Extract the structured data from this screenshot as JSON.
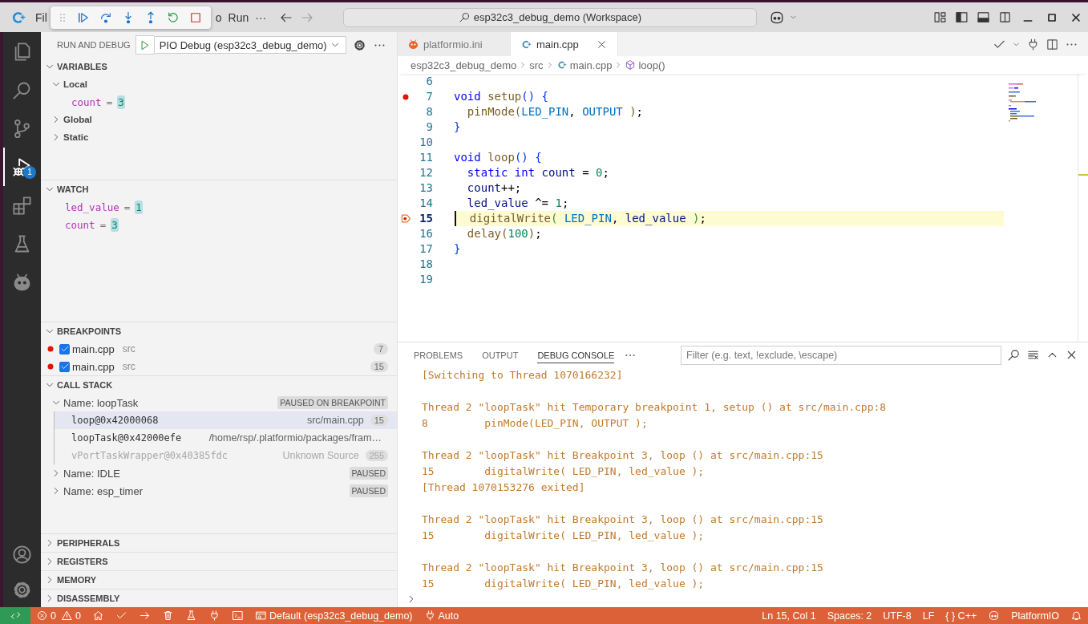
{
  "title_bar": {
    "menu_left": [
      "Fil"
    ],
    "menu_right": [
      "o",
      "Run",
      "···"
    ],
    "command_center": "esp32c3_debug_demo (Workspace)"
  },
  "activity_bar": {
    "items": [
      {
        "kind": "files",
        "selected": false
      },
      {
        "kind": "search",
        "selected": false
      },
      {
        "kind": "scm",
        "selected": false
      },
      {
        "kind": "debug",
        "selected": true,
        "badge": "1"
      },
      {
        "kind": "extensions",
        "selected": false
      },
      {
        "kind": "flask",
        "selected": false
      },
      {
        "kind": "alien",
        "selected": false
      }
    ],
    "bottom": [
      {
        "kind": "account",
        "selected": false
      },
      {
        "kind": "gear",
        "selected": false
      }
    ]
  },
  "sidebar": {
    "title": "RUN AND DEBUG",
    "config": "PIO Debug (esp32c3_debug_demo)",
    "sections": [
      {
        "kind": "variables",
        "title": "VARIABLES",
        "expanded": true,
        "scopes": [
          {
            "label": "Local",
            "expanded": true,
            "children": [
              {
                "name": "count",
                "sep": "=",
                "value": "3",
                "changed": true
              }
            ]
          },
          {
            "label": "Global",
            "expanded": false
          },
          {
            "label": "Static",
            "expanded": false
          }
        ]
      },
      {
        "kind": "watch",
        "title": "WATCH",
        "expanded": true,
        "items": [
          {
            "name": "led_value",
            "sep": "=",
            "value": "1",
            "changed": true
          },
          {
            "name": "count",
            "sep": "=",
            "value": "3",
            "changed": true
          }
        ]
      },
      {
        "kind": "breakpoints",
        "title": "BREAKPOINTS",
        "expanded": true,
        "items": [
          {
            "file": "main.cpp",
            "folder": "src",
            "line": "7",
            "checked": true
          },
          {
            "file": "main.cpp",
            "folder": "src",
            "line": "15",
            "checked": true
          }
        ]
      },
      {
        "kind": "callstack",
        "title": "CALL STACK",
        "expanded": true,
        "threads": [
          {
            "name": "Name: loopTask",
            "status": "PAUSED ON BREAKPOINT",
            "expanded": true,
            "frames": [
              {
                "name": "loop@0x42000068",
                "source": "src/main.cpp",
                "line": "15",
                "selected": true,
                "dimmed": false
              },
              {
                "name": "loopTask@0x42000efe",
                "source": "/home/rsp/.platformio/packages/fram…",
                "selected": false,
                "dimmed": false
              },
              {
                "name": "vPortTaskWrapper@0x40385fdc",
                "source": "Unknown Source",
                "line": "255",
                "selected": false,
                "dimmed": true
              }
            ]
          },
          {
            "name": "Name: IDLE",
            "status": "PAUSED",
            "expanded": false
          },
          {
            "name": "Name: esp_timer",
            "status": "PAUSED",
            "expanded": false
          }
        ]
      },
      {
        "kind": "collapsed",
        "title": "PERIPHERALS",
        "expanded": false
      },
      {
        "kind": "collapsed",
        "title": "REGISTERS",
        "expanded": false
      },
      {
        "kind": "collapsed",
        "title": "MEMORY",
        "expanded": false
      },
      {
        "kind": "collapsed",
        "title": "DISASSEMBLY",
        "expanded": false
      }
    ]
  },
  "editor": {
    "tabs": [
      {
        "label": "platformio.ini",
        "kind": "ini",
        "selected": false
      },
      {
        "label": "main.cpp",
        "kind": "cpp",
        "selected": true
      }
    ],
    "breadcrumbs": [
      {
        "label": "esp32c3_debug_demo",
        "kind": "folder"
      },
      {
        "label": "src",
        "kind": "folder"
      },
      {
        "label": "main.cpp",
        "kind": "file"
      },
      {
        "label": "loop()",
        "kind": "symbol"
      }
    ],
    "lines": [
      {
        "number": "6",
        "active": false,
        "breakpoint": false
      },
      {
        "number": "7",
        "active": false,
        "breakpoint": true,
        "tokens": [
          {
            "text": "void ",
            "kind": "kw"
          },
          {
            "text": "setup",
            "kind": "fn"
          },
          {
            "text": "() {",
            "kind": "br"
          }
        ]
      },
      {
        "number": "8",
        "active": false,
        "breakpoint": false,
        "tokens": [
          {
            "text": "  pinMode",
            "kind": "fn"
          },
          {
            "text": "(",
            "kind": "fn"
          },
          {
            "text": "LED_PIN",
            "kind": "mac"
          },
          {
            "text": ", ",
            "kind": "p"
          },
          {
            "text": "OUTPUT",
            "kind": "mac"
          },
          {
            "text": " )",
            "kind": "fn"
          },
          {
            "text": ";",
            "kind": "p"
          }
        ]
      },
      {
        "number": "9",
        "active": false,
        "breakpoint": false,
        "tokens": [
          {
            "text": "}",
            "kind": "br"
          }
        ]
      },
      {
        "number": "10",
        "active": false,
        "breakpoint": false
      },
      {
        "number": "11",
        "active": false,
        "breakpoint": false,
        "tokens": [
          {
            "text": "void ",
            "kind": "kw"
          },
          {
            "text": "loop",
            "kind": "fn"
          },
          {
            "text": "() {",
            "kind": "br"
          }
        ]
      },
      {
        "number": "12",
        "active": false,
        "breakpoint": false,
        "tokens": [
          {
            "text": "  static int ",
            "kind": "kw"
          },
          {
            "text": "count",
            "kind": "var"
          },
          {
            "text": " = ",
            "kind": "p"
          },
          {
            "text": "0",
            "kind": "num"
          },
          {
            "text": ";",
            "kind": "p"
          }
        ]
      },
      {
        "number": "13",
        "active": false,
        "breakpoint": false,
        "tokens": [
          {
            "text": "  count",
            "kind": "var"
          },
          {
            "text": "++;",
            "kind": "p"
          }
        ]
      },
      {
        "number": "14",
        "active": false,
        "breakpoint": false,
        "tokens": [
          {
            "text": "  led_value",
            "kind": "var"
          },
          {
            "text": " ^= ",
            "kind": "p"
          },
          {
            "text": "1",
            "kind": "num"
          },
          {
            "text": ";",
            "kind": "p"
          }
        ]
      },
      {
        "number": "15",
        "active": true,
        "breakpoint": true,
        "tokens": [
          {
            "text": "  digitalWrite",
            "kind": "fn"
          },
          {
            "text": "( ",
            "kind": "br2"
          },
          {
            "text": "LED_PIN",
            "kind": "mac"
          },
          {
            "text": ", ",
            "kind": "p"
          },
          {
            "text": "led_value",
            "kind": "var"
          },
          {
            "text": " )",
            "kind": "br2"
          },
          {
            "text": ";",
            "kind": "p"
          }
        ]
      },
      {
        "number": "16",
        "active": false,
        "breakpoint": false,
        "tokens": [
          {
            "text": "  delay",
            "kind": "fn"
          },
          {
            "text": "(",
            "kind": "fn"
          },
          {
            "text": "100",
            "kind": "num"
          },
          {
            "text": ")",
            "kind": "fn"
          },
          {
            "text": ";",
            "kind": "p"
          }
        ]
      },
      {
        "number": "17",
        "active": false,
        "breakpoint": false,
        "tokens": [
          {
            "text": "}",
            "kind": "br"
          }
        ]
      },
      {
        "number": "18",
        "active": false,
        "breakpoint": false
      },
      {
        "number": "19",
        "active": false,
        "breakpoint": false
      }
    ]
  },
  "panel": {
    "tabs": [
      {
        "label": "PROBLEMS",
        "selected": false
      },
      {
        "label": "OUTPUT",
        "selected": false
      },
      {
        "label": "DEBUG CONSOLE",
        "selected": true
      }
    ],
    "filter": {
      "placeholder": "Filter (e.g. text, !exclude, \\escape)"
    },
    "console": [
      [
        "[Switching to Thread 1070166232]"
      ],
      [
        "Thread 2 \"loopTask\" hit Temporary breakpoint 1, setup () at src/main.cpp:8",
        "8         pinMode(LED_PIN, OUTPUT );"
      ],
      [
        "Thread 2 \"loopTask\" hit Breakpoint 3, loop () at src/main.cpp:15",
        "15        digitalWrite( LED_PIN, led_value );",
        "[Thread 1070153276 exited]"
      ],
      [
        "Thread 2 \"loopTask\" hit Breakpoint 3, loop () at src/main.cpp:15",
        "15        digitalWrite( LED_PIN, led_value );"
      ],
      [
        "Thread 2 \"loopTask\" hit Breakpoint 3, loop () at src/main.cpp:15",
        "15        digitalWrite( LED_PIN, led_value );"
      ]
    ]
  },
  "status_bar": {
    "left": [
      {
        "kind": "remote"
      },
      {
        "kind": "problems",
        "errors": "0",
        "warnings": "0"
      },
      {
        "kind": "home"
      },
      {
        "kind": "check"
      },
      {
        "kind": "arrow"
      },
      {
        "kind": "trash"
      },
      {
        "kind": "flask"
      },
      {
        "kind": "plug"
      },
      {
        "kind": "terminal"
      },
      {
        "kind": "env",
        "text": "Default (esp32c3_debug_demo)"
      },
      {
        "kind": "port",
        "text": "Auto"
      }
    ],
    "right": [
      {
        "kind": "text",
        "text": "Ln 15, Col 1"
      },
      {
        "kind": "text",
        "text": "Spaces: 2"
      },
      {
        "kind": "text",
        "text": "UTF-8"
      },
      {
        "kind": "text",
        "text": "LF"
      },
      {
        "kind": "text",
        "text": "{ } C++"
      },
      {
        "kind": "copilot"
      },
      {
        "kind": "text",
        "text": "PlatformIO"
      },
      {
        "kind": "bell"
      }
    ]
  }
}
